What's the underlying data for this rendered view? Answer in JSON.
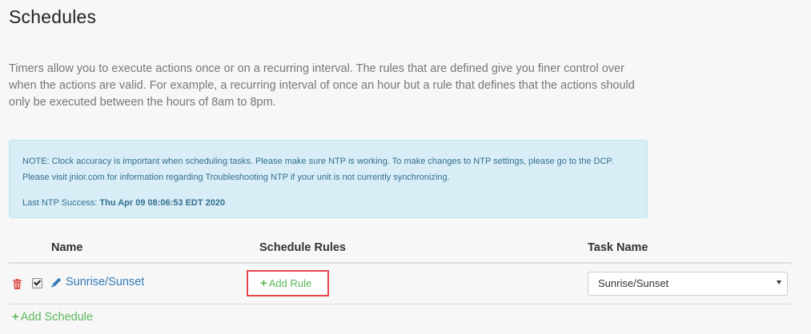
{
  "page": {
    "title": "Schedules",
    "description": "Timers allow you to execute actions once or on a recurring interval. The rules that are defined give you finer control over when the actions are valid. For example, a recurring interval of once an hour but a rule that defines that the actions should only be executed between the hours of 8am to 8pm."
  },
  "alert": {
    "text_before_link": "NOTE: Clock accuracy is important when scheduling tasks. Please make sure NTP is working. To make changes to NTP settings, please go to the ",
    "link_text": "DCP",
    "text_after_link": ". Please visit jnior.com for information regarding Troubleshooting NTP if your unit is not currently synchronizing.",
    "ntp_label": "Last NTP Success: ",
    "ntp_value": "Thu Apr 09 08:06:53 EDT 2020"
  },
  "table": {
    "columns": [
      "Name",
      "Schedule Rules",
      "Task Name"
    ],
    "rows": [
      {
        "name": "Sunrise/Sunset",
        "enabled": true,
        "add_rule_label": "Add Rule",
        "task_name": "Sunrise/Sunset"
      }
    ]
  },
  "actions": {
    "add_schedule_label": "Add Schedule"
  },
  "icons": {
    "delete": "trash-icon",
    "edit": "pencil-icon",
    "add": "plus-icon",
    "select": "chevron-down-icon"
  },
  "colors": {
    "link": "#337ab7",
    "add": "#5cb85c",
    "delete": "#d9534f",
    "alert_bg": "#d9edf7",
    "alert_text": "#31708f",
    "highlight": "#e5474b"
  }
}
